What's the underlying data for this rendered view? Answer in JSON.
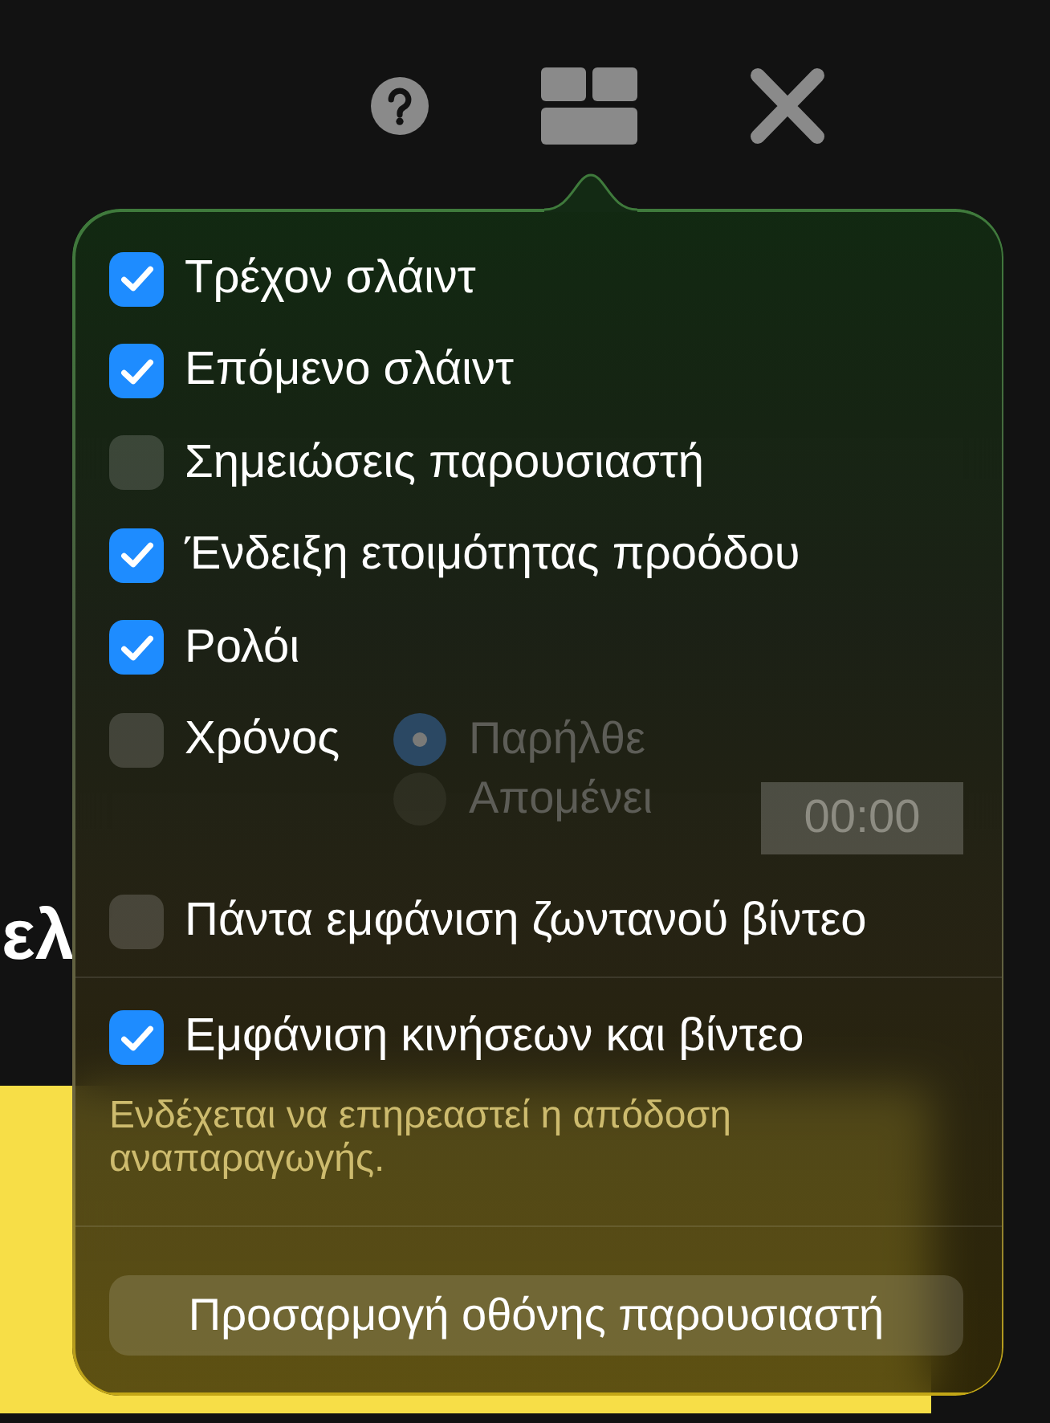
{
  "slide": {
    "title_fragment": "ελ"
  },
  "toolbar": {
    "buttons": [
      {
        "kind": "help"
      },
      {
        "kind": "layout"
      },
      {
        "kind": "close"
      }
    ]
  },
  "popover": {
    "options": [
      {
        "kind": "checkbox",
        "label": "Τρέχον σλάιντ",
        "checked": true
      },
      {
        "kind": "checkbox",
        "label": "Επόμενο σλάιντ",
        "checked": true
      },
      {
        "kind": "checkbox",
        "label": "Σημειώσεις παρουσιαστή",
        "checked": false
      },
      {
        "kind": "checkbox",
        "label": "Ένδειξη ετοιμότητας προόδου",
        "checked": true
      },
      {
        "kind": "checkbox",
        "label": "Ρολόι",
        "checked": true
      },
      {
        "kind": "timer",
        "label": "Χρόνος",
        "checked": false,
        "disabled": true,
        "modes": [
          {
            "label": "Παρήλθε",
            "selected": true
          },
          {
            "label": "Απομένει",
            "selected": false
          }
        ],
        "duration": "00:00"
      },
      {
        "kind": "checkbox",
        "label": "Πάντα εμφάνιση ζωντανού βίντεο",
        "checked": false
      }
    ],
    "motion": {
      "label": "Εμφάνιση κινήσεων και βίντεο",
      "checked": true,
      "note": "Ενδέχεται να επηρεαστεί η απόδοση αναπαραγωγής."
    },
    "button": {
      "label": "Προσαρμογή οθόνης παρουσιαστή"
    }
  }
}
